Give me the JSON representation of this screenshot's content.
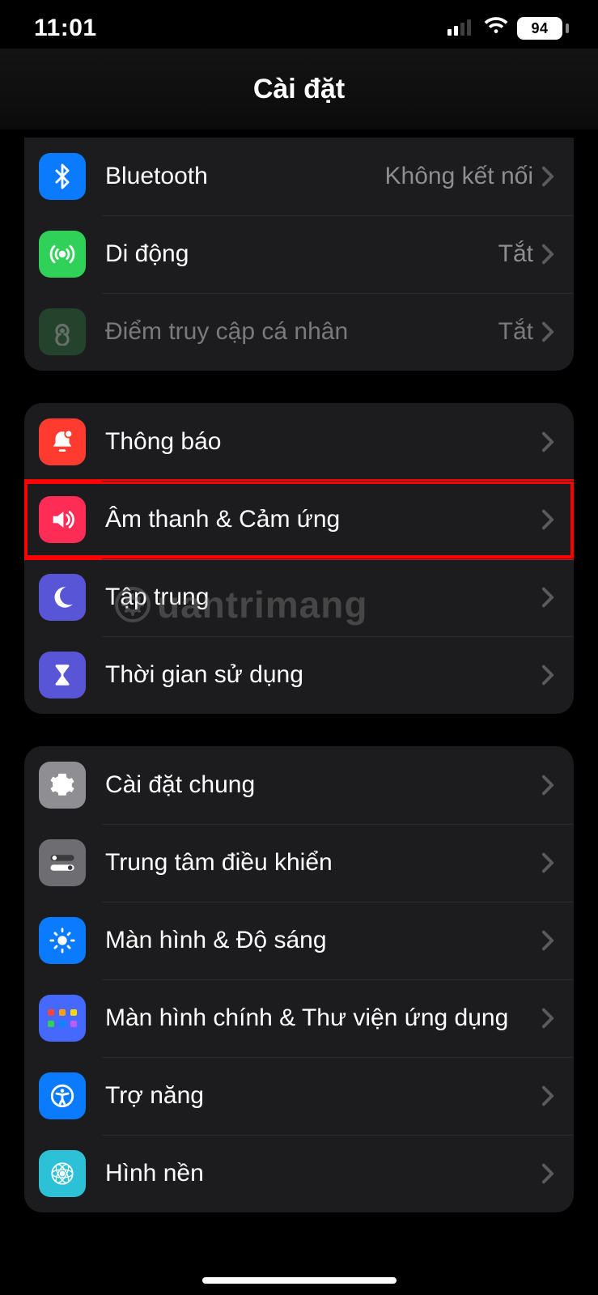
{
  "statusbar": {
    "time": "11:01",
    "battery": "94"
  },
  "page_title": "Cài đặt",
  "watermark": "uantrimang",
  "groups": {
    "g1": {
      "bluetooth": {
        "label": "Bluetooth",
        "value": "Không kết nối"
      },
      "cellular": {
        "label": "Di động",
        "value": "Tắt"
      },
      "hotspot": {
        "label": "Điểm truy cập cá nhân",
        "value": "Tắt"
      }
    },
    "g2": {
      "notifications": {
        "label": "Thông báo"
      },
      "sounds": {
        "label": "Âm thanh & Cảm ứng"
      },
      "focus": {
        "label": "Tập trung"
      },
      "screentime": {
        "label": "Thời gian sử dụng"
      }
    },
    "g3": {
      "general": {
        "label": "Cài đặt chung"
      },
      "controlcenter": {
        "label": "Trung tâm điều khiển"
      },
      "display": {
        "label": "Màn hình & Độ sáng"
      },
      "homescreen": {
        "label": "Màn hình chính & Thư viện ứng dụng"
      },
      "accessibility": {
        "label": "Trợ năng"
      },
      "wallpaper": {
        "label": "Hình nền"
      }
    }
  }
}
